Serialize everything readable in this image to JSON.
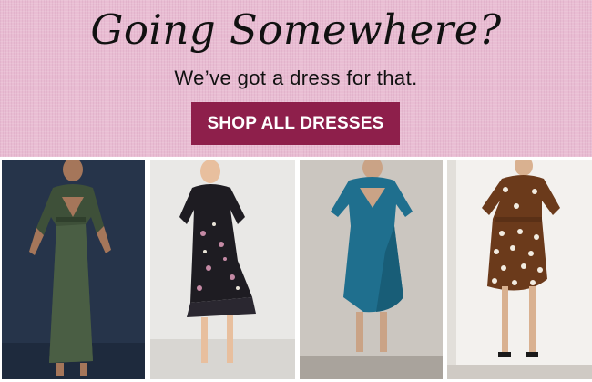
{
  "hero": {
    "headline": "Going Somewhere?",
    "subheadline": "We’ve got a dress for that.",
    "cta_label": "SHOP ALL DRESSES",
    "background_color": "#e9bdd3",
    "cta_color": "#8e1f4b"
  },
  "products": [
    {
      "name": "green velvet wrap maxi dress",
      "icon": "dress-photo",
      "dress_color": "#3e5039",
      "background": "#26344a"
    },
    {
      "name": "black floral mesh dress",
      "icon": "dress-photo",
      "dress_color": "#1e1c22",
      "background": "#e9e8e6"
    },
    {
      "name": "teal ruffle wrap dress",
      "icon": "dress-photo",
      "dress_color": "#1f6f8e",
      "background": "#cbc6c0"
    },
    {
      "name": "brown polka dot wrap dress",
      "icon": "dress-photo",
      "dress_color": "#6b3a1b",
      "background": "#f3f1ee"
    }
  ]
}
